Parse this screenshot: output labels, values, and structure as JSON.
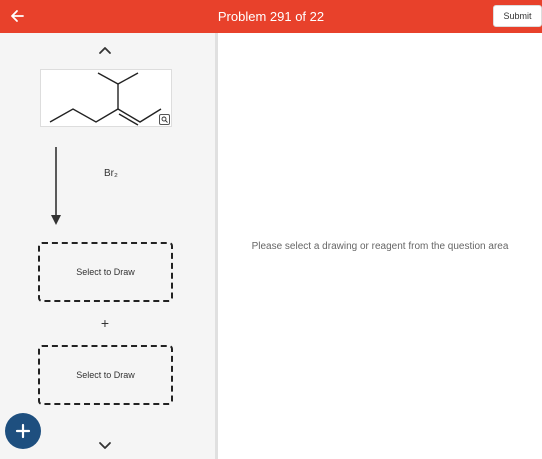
{
  "header": {
    "title": "Problem 291 of 22",
    "submit_label": "Submit",
    "back_icon": "arrow-left-icon",
    "color": "#e8412b"
  },
  "left_panel": {
    "reagent": "Br₂",
    "answer_slots": [
      {
        "label": "Select to Draw"
      },
      {
        "label": "Select to Draw"
      }
    ],
    "plus_symbol": "+",
    "icons": [
      "chevron-up-icon",
      "zoom-icon",
      "reaction-arrow-icon",
      "chevron-down-icon",
      "add-icon"
    ]
  },
  "right_panel": {
    "hint": "Please select a drawing or reagent from the question area"
  },
  "colors": {
    "fab": "#1e4f7f",
    "panel_bg": "#f5f5f5"
  }
}
